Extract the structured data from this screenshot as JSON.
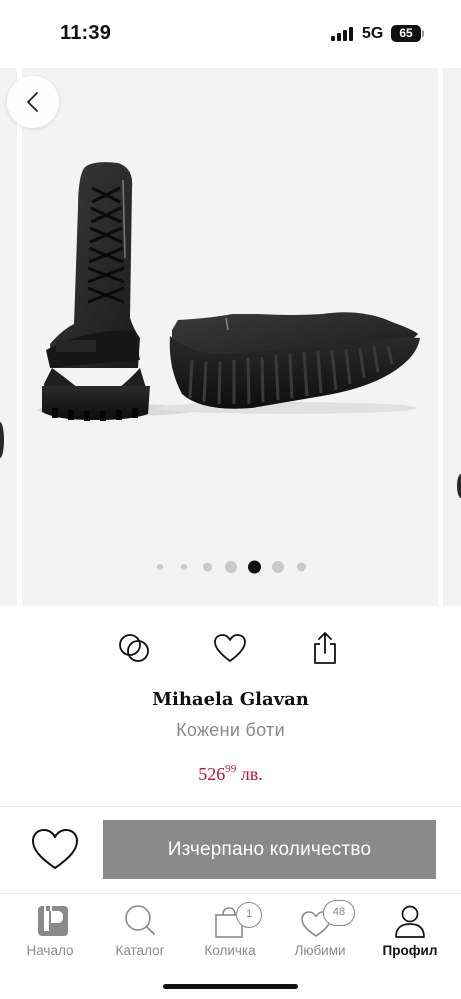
{
  "status_bar": {
    "time": "11:39",
    "network": "5G",
    "battery": "65"
  },
  "carousel": {
    "image_alt": "black leather lace-up ankle boots with strap and ridged platform sole",
    "total_slides": 7,
    "active_slide": 5,
    "back_icon": "chevron-left-icon"
  },
  "actions": {
    "compare_icon": "compare-circles-icon",
    "favorite_icon": "heart-icon",
    "share_icon": "share-icon"
  },
  "product": {
    "brand": "Mihaela Glavan",
    "name": "Кожени боти",
    "price_main": "526",
    "price_decimals": "99",
    "currency": "лв."
  },
  "cta": {
    "button_label": "Изчерпано количество",
    "favorite_icon": "heart-icon"
  },
  "tabbar": {
    "tabs": [
      {
        "label": "Начало",
        "icon": "fashion-days-logo-icon",
        "active": false
      },
      {
        "label": "Каталог",
        "icon": "search-icon",
        "active": false
      },
      {
        "label": "Количка",
        "icon": "shopping-bag-icon",
        "active": false,
        "badge": "1"
      },
      {
        "label": "Любими",
        "icon": "heart-icon",
        "active": false,
        "badge": "48"
      },
      {
        "label": "Профил",
        "icon": "user-icon",
        "active": true
      }
    ]
  },
  "colors": {
    "price": "#c8102e",
    "button_disabled": "#8a8a8a",
    "inactive_tab": "#8a8a8a"
  }
}
